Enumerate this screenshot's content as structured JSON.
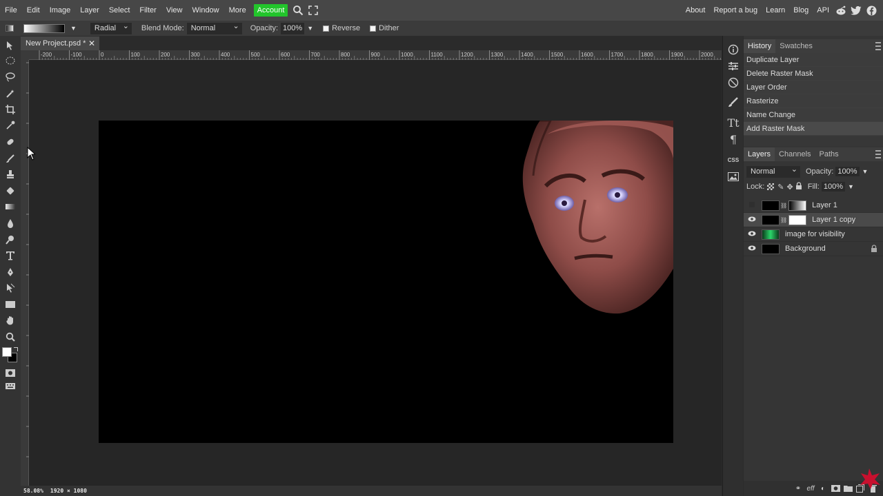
{
  "menubar": {
    "items": [
      "File",
      "Edit",
      "Image",
      "Layer",
      "Select",
      "Filter",
      "View",
      "Window",
      "More"
    ],
    "account": "Account",
    "right_links": [
      "About",
      "Report a bug",
      "Learn",
      "Blog",
      "API"
    ],
    "social_icons": [
      "reddit-icon",
      "twitter-icon",
      "facebook-icon"
    ],
    "accent_green": "#22c52b"
  },
  "options": {
    "gradient_type": "Radial",
    "blend_mode_label": "Blend Mode:",
    "blend_mode_value": "Normal",
    "opacity_label": "Opacity:",
    "opacity_value": "100%",
    "reverse_label": "Reverse",
    "dither_label": "Dither"
  },
  "document": {
    "tab_name": "New Project.psd *",
    "zoom": "58.08%",
    "size": "1920 × 1080"
  },
  "ruler": {
    "labels": [
      "-200",
      "-100",
      "0",
      "100",
      "200",
      "300",
      "400",
      "500",
      "600",
      "700",
      "800",
      "900",
      "1000",
      "1100",
      "1200",
      "1300",
      "1400",
      "1500",
      "1600",
      "1700",
      "1800",
      "1900",
      "2000"
    ]
  },
  "history": {
    "tabs": [
      "History",
      "Swatches"
    ],
    "items": [
      "Duplicate Layer",
      "Delete Raster Mask",
      "Layer Order",
      "Rasterize",
      "Name Change",
      "Add Raster Mask"
    ]
  },
  "layers": {
    "tabs": [
      "Layers",
      "Channels",
      "Paths"
    ],
    "blend_mode": "Normal",
    "opacity_label": "Opacity:",
    "opacity_value": "100%",
    "lock_label": "Lock:",
    "fill_label": "Fill:",
    "fill_value": "100%",
    "items": [
      {
        "name": "Layer 1",
        "visible": false
      },
      {
        "name": "Layer 1 copy",
        "visible": true
      },
      {
        "name": "image for visibility",
        "visible": true
      },
      {
        "name": "Background",
        "visible": true,
        "locked": true
      }
    ]
  },
  "side_icons": [
    "info-icon",
    "adjustments-icon",
    "navigator-icon",
    "brush-settings-icon",
    "character-icon",
    "paragraph-icon",
    "css-icon",
    "image-icon"
  ],
  "side_css_label": "CSS"
}
